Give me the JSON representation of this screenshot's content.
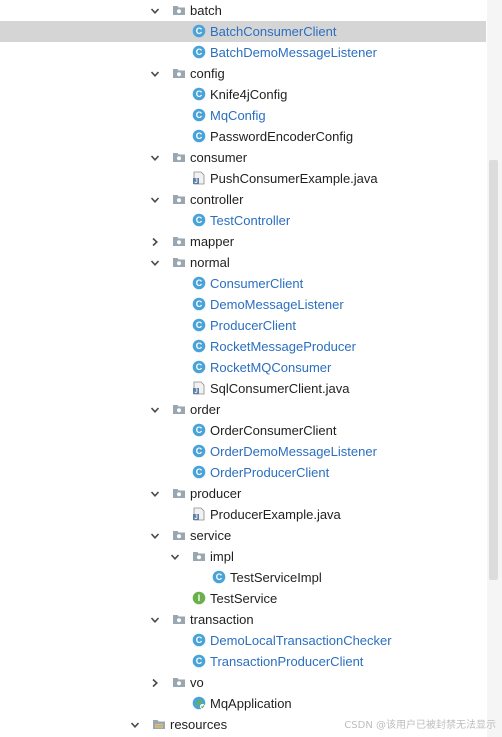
{
  "tree": [
    {
      "kind": "folder",
      "label": "batch",
      "expanded": true,
      "indent": 0
    },
    {
      "kind": "class",
      "label": "BatchConsumerClient",
      "indent": 1,
      "color": "blue",
      "selected": true
    },
    {
      "kind": "class",
      "label": "BatchDemoMessageListener",
      "indent": 1,
      "color": "blue"
    },
    {
      "kind": "folder",
      "label": "config",
      "expanded": true,
      "indent": 0
    },
    {
      "kind": "class",
      "label": "Knife4jConfig",
      "indent": 1,
      "color": "dark"
    },
    {
      "kind": "class",
      "label": "MqConfig",
      "indent": 1,
      "color": "blue"
    },
    {
      "kind": "class",
      "label": "PasswordEncoderConfig",
      "indent": 1,
      "color": "dark"
    },
    {
      "kind": "folder",
      "label": "consumer",
      "expanded": true,
      "indent": 0
    },
    {
      "kind": "javafile",
      "label": "PushConsumerExample.java",
      "indent": 1,
      "color": "dark"
    },
    {
      "kind": "folder",
      "label": "controller",
      "expanded": true,
      "indent": 0
    },
    {
      "kind": "class",
      "label": "TestController",
      "indent": 1,
      "color": "blue"
    },
    {
      "kind": "folder",
      "label": "mapper",
      "expanded": false,
      "indent": 0
    },
    {
      "kind": "folder",
      "label": "normal",
      "expanded": true,
      "indent": 0
    },
    {
      "kind": "class",
      "label": "ConsumerClient",
      "indent": 1,
      "color": "blue"
    },
    {
      "kind": "class",
      "label": "DemoMessageListener",
      "indent": 1,
      "color": "blue"
    },
    {
      "kind": "class",
      "label": "ProducerClient",
      "indent": 1,
      "color": "blue"
    },
    {
      "kind": "class",
      "label": "RocketMessageProducer",
      "indent": 1,
      "color": "blue"
    },
    {
      "kind": "class",
      "label": "RocketMQConsumer",
      "indent": 1,
      "color": "blue"
    },
    {
      "kind": "javafile",
      "label": "SqlConsumerClient.java",
      "indent": 1,
      "color": "dark"
    },
    {
      "kind": "folder",
      "label": "order",
      "expanded": true,
      "indent": 0
    },
    {
      "kind": "class",
      "label": "OrderConsumerClient",
      "indent": 1,
      "color": "dark"
    },
    {
      "kind": "class",
      "label": "OrderDemoMessageListener",
      "indent": 1,
      "color": "blue"
    },
    {
      "kind": "class",
      "label": "OrderProducerClient",
      "indent": 1,
      "color": "blue"
    },
    {
      "kind": "folder",
      "label": "producer",
      "expanded": true,
      "indent": 0
    },
    {
      "kind": "javafile",
      "label": "ProducerExample.java",
      "indent": 1,
      "color": "dark"
    },
    {
      "kind": "folder",
      "label": "service",
      "expanded": true,
      "indent": 0
    },
    {
      "kind": "folder",
      "label": "impl",
      "expanded": true,
      "indent": 1
    },
    {
      "kind": "class",
      "label": "TestServiceImpl",
      "indent": 2,
      "color": "dark"
    },
    {
      "kind": "interface",
      "label": "TestService",
      "indent": 1,
      "color": "dark"
    },
    {
      "kind": "folder",
      "label": "transaction",
      "expanded": true,
      "indent": 0
    },
    {
      "kind": "class",
      "label": "DemoLocalTransactionChecker",
      "indent": 1,
      "color": "blue"
    },
    {
      "kind": "class",
      "label": "TransactionProducerClient",
      "indent": 1,
      "color": "blue"
    },
    {
      "kind": "folder",
      "label": "vo",
      "expanded": false,
      "indent": 0
    },
    {
      "kind": "springapp",
      "label": "MqApplication",
      "indent": 1,
      "color": "dark"
    },
    {
      "kind": "resfolder",
      "label": "resources",
      "expanded": true,
      "indent": -1
    }
  ],
  "icon_names": {
    "folder": "package-folder-icon",
    "class": "java-class-icon",
    "javafile": "java-file-icon",
    "interface": "java-interface-icon",
    "springapp": "spring-boot-app-icon",
    "resfolder": "resources-folder-icon"
  },
  "colors": {
    "selected_row": "#d5d5d5",
    "class_blue": "#2a6fc0",
    "class_icon": "#4aa3d8",
    "interface_icon": "#6ab04c",
    "folder": "#9aa7b0"
  },
  "watermark": "CSDN @该用户已被封禁无法显示"
}
